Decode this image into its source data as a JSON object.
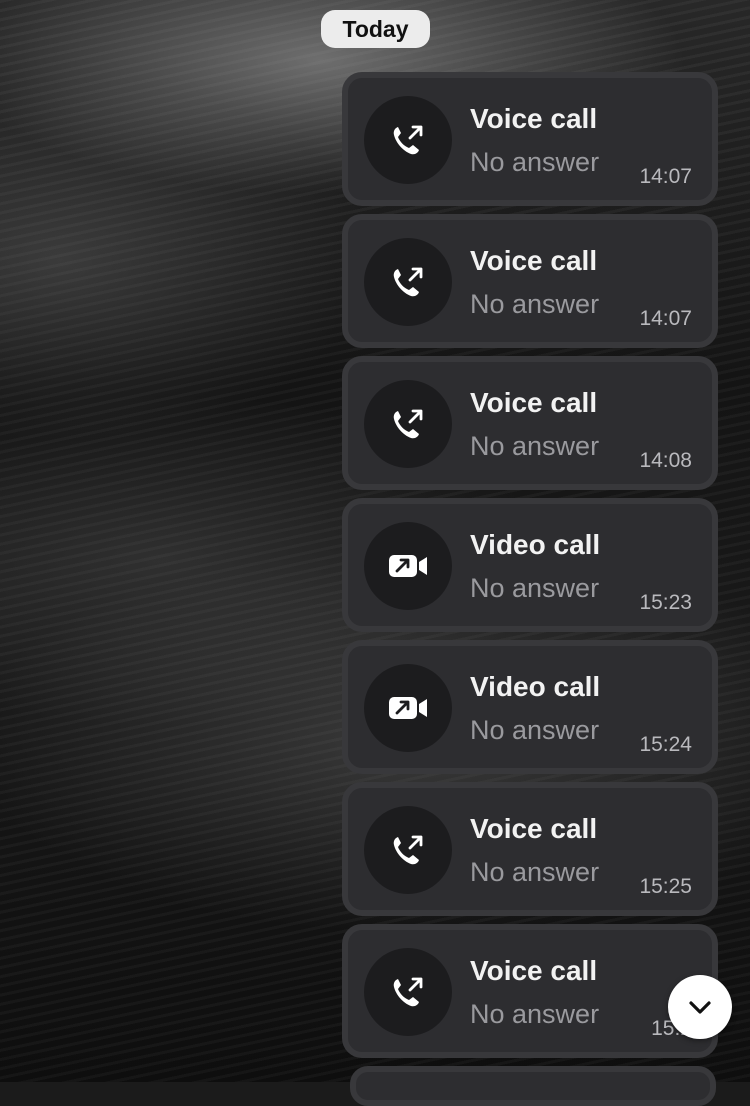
{
  "date_separator": "Today",
  "calls": [
    {
      "title": "Voice call",
      "status": "No answer",
      "time": "14:07",
      "icon": "outgoing-voice-call-icon"
    },
    {
      "title": "Voice call",
      "status": "No answer",
      "time": "14:07",
      "icon": "outgoing-voice-call-icon"
    },
    {
      "title": "Voice call",
      "status": "No answer",
      "time": "14:08",
      "icon": "outgoing-voice-call-icon"
    },
    {
      "title": "Video call",
      "status": "No answer",
      "time": "15:23",
      "icon": "outgoing-video-call-icon"
    },
    {
      "title": "Video call",
      "status": "No answer",
      "time": "15:24",
      "icon": "outgoing-video-call-icon"
    },
    {
      "title": "Voice call",
      "status": "No answer",
      "time": "15:25",
      "icon": "outgoing-voice-call-icon"
    },
    {
      "title": "Voice call",
      "status": "No answer",
      "time": "15:2",
      "icon": "outgoing-voice-call-icon"
    }
  ],
  "scroll_button": {
    "icon": "chevron-down-icon"
  },
  "colors": {
    "bubble": "#2d2d30",
    "icon_circle": "#1c1c1e",
    "pill": "#ececec"
  }
}
